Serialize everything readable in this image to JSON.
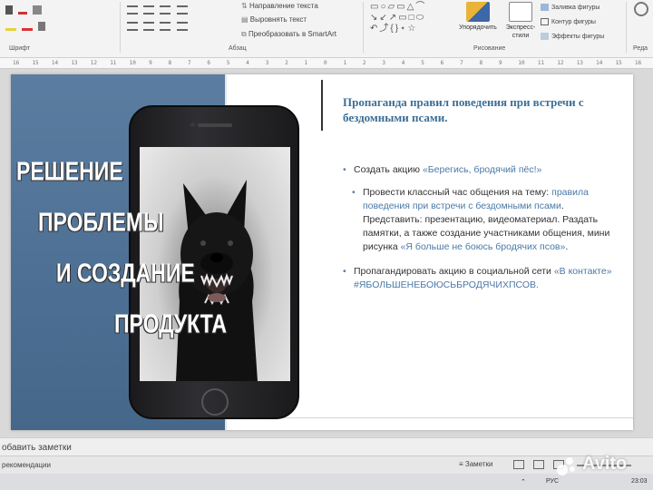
{
  "ribbon": {
    "groups": {
      "font_label": "Шрифт",
      "paragraph_label": "Абзац",
      "drawing_label": "Рисование",
      "edit_label": "Реда"
    },
    "paragraph": {
      "text_direction": "Направление текста",
      "align_text": "Выровнять текст",
      "convert_smartart": "Преобразовать в SmartArt"
    },
    "drawing": {
      "arrange": "Упорядочить",
      "quick_styles_line1": "Экспресс-",
      "quick_styles_line2": "стили",
      "shape_fill": "Заливка фигуры",
      "shape_outline": "Контур фигуры",
      "shape_effects": "Эффекты фигуры"
    }
  },
  "ruler": [
    "16",
    "15",
    "14",
    "13",
    "12",
    "11",
    "10",
    "9",
    "8",
    "7",
    "6",
    "5",
    "4",
    "3",
    "2",
    "1",
    "0",
    "1",
    "2",
    "3",
    "4",
    "5",
    "6",
    "7",
    "8",
    "9",
    "10",
    "11",
    "12",
    "13",
    "14",
    "15",
    "16"
  ],
  "slide": {
    "slogan": [
      "РЕШЕНИЕ",
      "ПРОБЛЕМЫ",
      "И СОЗДАНИЕ",
      "ПРОДУКТА"
    ],
    "title": "Пропаганда правил поведения при встречи с бездомными псами.",
    "bullet1": {
      "prefix": "Создать акцию ",
      "highlight": "«Берегись, бродячий пёс!»"
    },
    "sub1": {
      "prefix": "Провести классный час общения на тему: ",
      "highlight1": "правила поведения при встречи с бездомными псами",
      "middle": ". Представить: презентацию, видеоматериал. Раздать памятки, а также создание участниками общения, мини рисунка ",
      "highlight2": "«Я больше не боюсь бродячих псов»",
      "suffix": "."
    },
    "bullet2": {
      "prefix": "Пропагандировать акцию в социальной сети ",
      "highlight": "«В контакте» #ЯБОЛЬШЕНЕБОЮСЬБРОДЯЧИХПСОВ."
    }
  },
  "notes_bar": {
    "label": "обавить заметки"
  },
  "status_bar": {
    "notes_button": "Заметки",
    "left_text": "рекомендации"
  },
  "taskbar": {
    "lang": "РУС",
    "time": "23:03"
  },
  "watermark": {
    "text": "Avito"
  },
  "colors": {
    "slide_blue": "#5b7da0",
    "title_blue": "#3b6e96",
    "highlight_blue": "#4a79a8"
  }
}
